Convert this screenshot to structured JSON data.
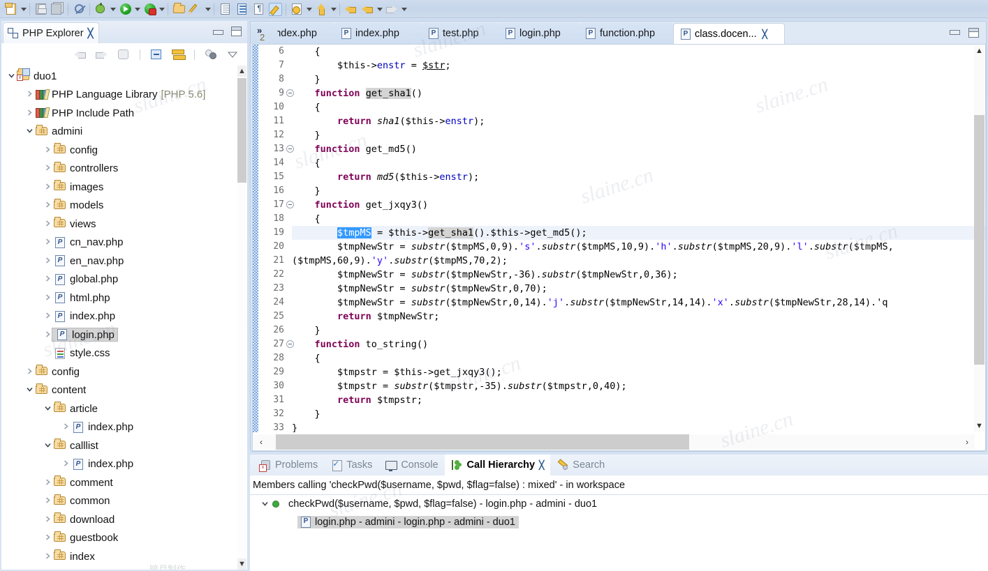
{
  "toolbar": {
    "items": [
      {
        "name": "new-file",
        "icon": "new-file-icon",
        "has_dropdown": true
      },
      {
        "name": "save",
        "icon": "save-icon",
        "has_dropdown": false
      },
      {
        "name": "save-all",
        "icon": "save-all-icon",
        "has_dropdown": false
      },
      {
        "name": "no-marker",
        "icon": "no-marker-icon",
        "has_dropdown": false
      },
      {
        "name": "debug",
        "icon": "bug-icon",
        "has_dropdown": true
      },
      {
        "name": "run",
        "icon": "run-green-play-icon",
        "has_dropdown": true
      },
      {
        "name": "run-external",
        "icon": "run-external-tool-icon",
        "has_dropdown": true
      },
      {
        "name": "open-folder",
        "icon": "open-folder-icon",
        "has_dropdown": false
      },
      {
        "name": "brush",
        "icon": "pencil-icon",
        "has_dropdown": true
      },
      {
        "name": "new-php-file",
        "icon": "document-arrow-icon",
        "has_dropdown": false
      },
      {
        "name": "document",
        "icon": "document-blue-icon",
        "has_dropdown": false
      },
      {
        "name": "paragraph",
        "icon": "paragraph-icon",
        "has_dropdown": false
      },
      {
        "name": "highlight",
        "icon": "highlight-pencil-icon",
        "has_dropdown": false
      },
      {
        "name": "annotate",
        "icon": "document-star-icon",
        "has_dropdown": true
      },
      {
        "name": "up",
        "icon": "up-arrow-icon",
        "has_dropdown": true
      },
      {
        "name": "back",
        "icon": "back-arrow-icon",
        "has_dropdown": false
      },
      {
        "name": "backward",
        "icon": "back-arrow-yellow-icon",
        "has_dropdown": true
      },
      {
        "name": "forward",
        "icon": "forward-arrow-gray-icon",
        "has_dropdown": true
      }
    ]
  },
  "explorer": {
    "tab_title": "PHP Explorer",
    "tab_icon": "php-explorer-icon",
    "close_glyph": "╳",
    "minimize_title": "Minimize",
    "maximize_title": "Maximize",
    "toolbar": [
      {
        "name": "back-button",
        "icon": "back-arrow-icon"
      },
      {
        "name": "forward-button",
        "icon": "forward-arrow-icon"
      },
      {
        "name": "up-button",
        "icon": "up-one-level-icon"
      },
      {
        "name": "collapse-all-button",
        "icon": "collapse-all-icon"
      },
      {
        "name": "link-with-editor-button",
        "icon": "link-with-editor-icon"
      },
      {
        "name": "filter-button",
        "icon": "filter-icon"
      },
      {
        "name": "view-menu-button",
        "icon": "view-menu-icon"
      }
    ],
    "tree": [
      {
        "label": "duo1",
        "suffix": "",
        "icon": "project-icon",
        "indent": 0,
        "twisty": "open",
        "selected": false
      },
      {
        "label": "PHP Language Library",
        "suffix": "[PHP 5.6]",
        "icon": "library-icon",
        "indent": 1,
        "twisty": "closed",
        "selected": false
      },
      {
        "label": "PHP Include Path",
        "suffix": "",
        "icon": "library-icon",
        "indent": 1,
        "twisty": "closed",
        "selected": false
      },
      {
        "label": "admini",
        "suffix": "",
        "icon": "source-folder-icon",
        "indent": 1,
        "twisty": "open",
        "selected": false
      },
      {
        "label": "config",
        "suffix": "",
        "icon": "source-folder-icon",
        "indent": 2,
        "twisty": "closed",
        "selected": false
      },
      {
        "label": "controllers",
        "suffix": "",
        "icon": "source-folder-icon",
        "indent": 2,
        "twisty": "closed",
        "selected": false
      },
      {
        "label": "images",
        "suffix": "",
        "icon": "source-folder-icon",
        "indent": 2,
        "twisty": "closed",
        "selected": false
      },
      {
        "label": "models",
        "suffix": "",
        "icon": "source-folder-icon",
        "indent": 2,
        "twisty": "closed",
        "selected": false
      },
      {
        "label": "views",
        "suffix": "",
        "icon": "source-folder-icon",
        "indent": 2,
        "twisty": "closed",
        "selected": false
      },
      {
        "label": "cn_nav.php",
        "suffix": "",
        "icon": "php-file-icon",
        "indent": 2,
        "twisty": "closed",
        "selected": false
      },
      {
        "label": "en_nav.php",
        "suffix": "",
        "icon": "php-file-icon",
        "indent": 2,
        "twisty": "closed",
        "selected": false
      },
      {
        "label": "global.php",
        "suffix": "",
        "icon": "php-file-icon",
        "indent": 2,
        "twisty": "closed",
        "selected": false
      },
      {
        "label": "html.php",
        "suffix": "",
        "icon": "php-file-icon",
        "indent": 2,
        "twisty": "closed",
        "selected": false
      },
      {
        "label": "index.php",
        "suffix": "",
        "icon": "php-file-icon",
        "indent": 2,
        "twisty": "closed",
        "selected": false
      },
      {
        "label": "login.php",
        "suffix": "",
        "icon": "php-file-icon",
        "indent": 2,
        "twisty": "closed",
        "selected": true
      },
      {
        "label": "style.css",
        "suffix": "",
        "icon": "css-file-icon",
        "indent": 2,
        "twisty": "none",
        "selected": false
      },
      {
        "label": "config",
        "suffix": "",
        "icon": "source-folder-icon",
        "indent": 1,
        "twisty": "closed",
        "selected": false
      },
      {
        "label": "content",
        "suffix": "",
        "icon": "source-folder-icon",
        "indent": 1,
        "twisty": "open",
        "selected": false
      },
      {
        "label": "article",
        "suffix": "",
        "icon": "source-folder-icon",
        "indent": 2,
        "twisty": "open",
        "selected": false
      },
      {
        "label": "index.php",
        "suffix": "",
        "icon": "php-file-icon",
        "indent": 3,
        "twisty": "closed",
        "selected": false
      },
      {
        "label": "calllist",
        "suffix": "",
        "icon": "source-folder-icon",
        "indent": 2,
        "twisty": "open",
        "selected": false
      },
      {
        "label": "index.php",
        "suffix": "",
        "icon": "php-file-icon",
        "indent": 3,
        "twisty": "closed",
        "selected": false
      },
      {
        "label": "comment",
        "suffix": "",
        "icon": "source-folder-icon",
        "indent": 2,
        "twisty": "closed",
        "selected": false
      },
      {
        "label": "common",
        "suffix": "",
        "icon": "source-folder-icon",
        "indent": 2,
        "twisty": "closed",
        "selected": false
      },
      {
        "label": "download",
        "suffix": "",
        "icon": "source-folder-icon",
        "indent": 2,
        "twisty": "closed",
        "selected": false
      },
      {
        "label": "guestbook",
        "suffix": "",
        "icon": "source-folder-icon",
        "indent": 2,
        "twisty": "closed",
        "selected": false
      },
      {
        "label": "index",
        "suffix": "",
        "icon": "source-folder-icon",
        "indent": 2,
        "twisty": "closed",
        "selected": false
      }
    ]
  },
  "editor": {
    "tabs": [
      {
        "label": "index.php",
        "active": false,
        "closable": false
      },
      {
        "label": "index.php",
        "active": false,
        "closable": false
      },
      {
        "label": "test.php",
        "active": false,
        "closable": false
      },
      {
        "label": "login.php",
        "active": false,
        "closable": false
      },
      {
        "label": "function.php",
        "active": false,
        "closable": false
      },
      {
        "label": "class.docen...",
        "active": true,
        "closable": true
      }
    ],
    "overflow_chevron": "»",
    "overflow_count": "2",
    "close_glyph": "╳",
    "lines": [
      {
        "no": "6",
        "fold": false,
        "current": false
      },
      {
        "no": "7",
        "fold": false,
        "current": false
      },
      {
        "no": "8",
        "fold": false,
        "current": false
      },
      {
        "no": "9",
        "fold": true,
        "current": false
      },
      {
        "no": "10",
        "fold": false,
        "current": false
      },
      {
        "no": "11",
        "fold": false,
        "current": false
      },
      {
        "no": "12",
        "fold": false,
        "current": false
      },
      {
        "no": "13",
        "fold": true,
        "current": false
      },
      {
        "no": "14",
        "fold": false,
        "current": false
      },
      {
        "no": "15",
        "fold": false,
        "current": false
      },
      {
        "no": "16",
        "fold": false,
        "current": false
      },
      {
        "no": "17",
        "fold": true,
        "current": false
      },
      {
        "no": "18",
        "fold": false,
        "current": false
      },
      {
        "no": "19",
        "fold": false,
        "current": true
      },
      {
        "no": "20",
        "fold": false,
        "current": false
      },
      {
        "no": "21",
        "fold": false,
        "current": false
      },
      {
        "no": "22",
        "fold": false,
        "current": false
      },
      {
        "no": "23",
        "fold": false,
        "current": false
      },
      {
        "no": "24",
        "fold": false,
        "current": false
      },
      {
        "no": "25",
        "fold": false,
        "current": false
      },
      {
        "no": "26",
        "fold": false,
        "current": false
      },
      {
        "no": "27",
        "fold": true,
        "current": false
      },
      {
        "no": "28",
        "fold": false,
        "current": false
      },
      {
        "no": "29",
        "fold": false,
        "current": false
      },
      {
        "no": "30",
        "fold": false,
        "current": false
      },
      {
        "no": "31",
        "fold": false,
        "current": false
      },
      {
        "no": "32",
        "fold": false,
        "current": false
      },
      {
        "no": "33",
        "fold": false,
        "current": false
      }
    ],
    "code_text": [
      "    {",
      "        $this->enstr = $str;",
      "    }",
      "    function get_sha1()",
      "    {",
      "        return sha1($this->enstr);",
      "    }",
      "    function get_md5()",
      "    {",
      "        return md5($this->enstr);",
      "    }",
      "    function get_jxqy3()",
      "    {",
      "        $tmpMS = $this->get_sha1().$this->get_md5();",
      "        $tmpNewStr = substr($tmpMS,0,9).'s'.substr($tmpMS,10,9).'h'.substr($tmpMS,20,9).'l'.substr($tmpMS,",
      "($tmpMS,60,9).'y'.substr($tmpMS,70,2);",
      "        $tmpNewStr = substr($tmpNewStr,-36).substr($tmpNewStr,0,36);",
      "        $tmpNewStr = substr($tmpNewStr,0,70);",
      "        $tmpNewStr = substr($tmpNewStr,0,14).'j'.substr($tmpNewStr,14,14).'x'.substr($tmpNewStr,28,14).'q",
      "        return $tmpNewStr;",
      "    }",
      "    function to_string()",
      "    {",
      "        $tmpstr = $this->get_jxqy3();",
      "        $tmpstr = substr($tmpstr,-35).substr($tmpstr,0,40);",
      "        return $tmpstr;",
      "    }",
      "}"
    ],
    "selection_text": "$tmpMS"
  },
  "bottom": {
    "tabs": [
      {
        "label": "Problems",
        "icon": "problems-icon",
        "active": false,
        "closable": false
      },
      {
        "label": "Tasks",
        "icon": "tasks-icon",
        "active": false,
        "closable": false
      },
      {
        "label": "Console",
        "icon": "console-icon",
        "active": false,
        "closable": false
      },
      {
        "label": "Call Hierarchy",
        "icon": "call-hierarchy-icon",
        "active": true,
        "closable": true
      },
      {
        "label": "Search",
        "icon": "search-icon",
        "active": false,
        "closable": false
      }
    ],
    "close_glyph": "╳",
    "description": "Members calling 'checkPwd($username, $pwd, $flag=false) : mixed' - in workspace",
    "hierarchy": [
      {
        "label": "checkPwd($username, $pwd, $flag=false) - login.php - admini - duo1",
        "indent": 0,
        "twisty": "open",
        "icon": "green-dot-icon",
        "selected": false
      },
      {
        "label": "login.php - admini - login.php - admini - duo1",
        "indent": 1,
        "twisty": "none",
        "icon": "php-file-icon",
        "selected": true
      }
    ]
  },
  "watermarks": {
    "text": "slaine.cn",
    "footer_cn": "暗月制作"
  }
}
